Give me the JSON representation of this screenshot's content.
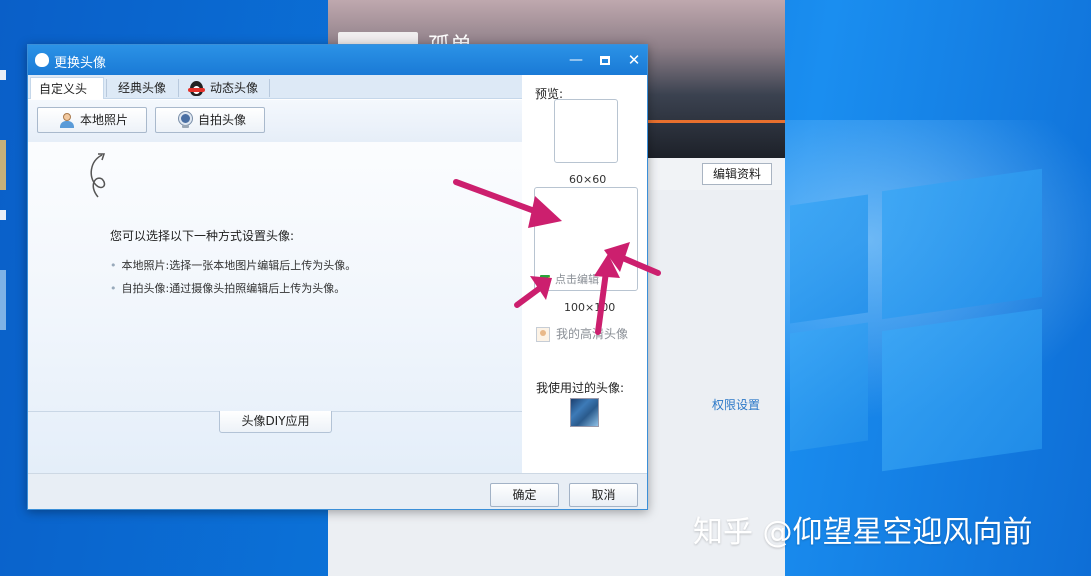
{
  "dialog": {
    "title": "更换头像",
    "titlebar_buttons": {
      "minimize": "—",
      "close": "✕"
    },
    "tabs": [
      {
        "label": "自定义头像"
      },
      {
        "label": "经典头像"
      },
      {
        "label": "动态头像"
      }
    ],
    "toolbar": {
      "local_photo_label": "本地照片",
      "selfie_label": "自拍头像"
    },
    "instructions": {
      "title": "您可以选择以下一种方式设置头像:",
      "items": [
        "本地照片:选择一张本地图片编辑后上传为头像。",
        "自拍头像:通过摄像头拍照编辑后上传为头像。"
      ]
    },
    "diy_button": "头像DIY应用",
    "preview": {
      "label": "预览:",
      "size_small": "60×60",
      "edit_link": "点击编辑",
      "size_large": "100×100",
      "hd_link": "我的高清头像",
      "used_label": "我使用过的头像:"
    },
    "footer": {
      "ok_label": "确定",
      "cancel_label": "取消"
    }
  },
  "background_window": {
    "name_fragment": "孤单",
    "edit_profile": "编辑资料",
    "permissions": "权限设置"
  },
  "watermark": "知乎 @仰望星空迎风向前",
  "colors": {
    "titlebar": "#1f86dd",
    "arrow": "#cc1f6e",
    "desktop": "#0b73d9",
    "link": "#2b78c8"
  }
}
